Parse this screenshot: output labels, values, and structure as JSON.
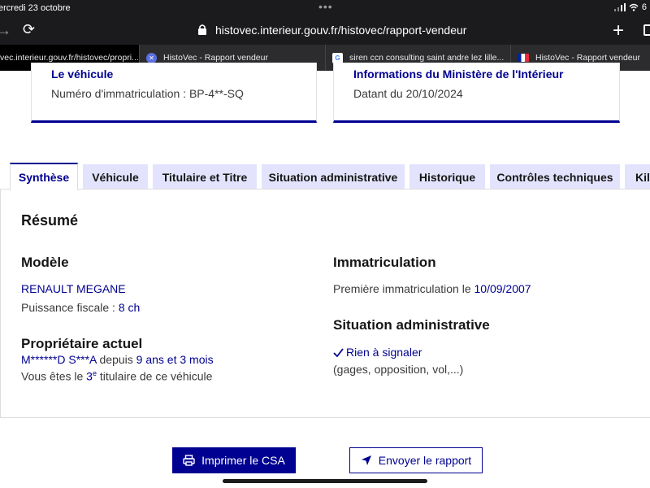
{
  "status_bar": {
    "date": "ercredi 23 octobre",
    "battery": "6"
  },
  "address_bar": {
    "url": "histovec.interieur.gouv.fr/histovec/rapport-vendeur"
  },
  "browser_tabs": [
    {
      "label": "vec.interieur.gouv.fr/histovec/propri...",
      "favicon": "none"
    },
    {
      "label": "HistoVec - Rapport vendeur",
      "favicon": "histovec-icon"
    },
    {
      "label": "siren ccn consulting saint andre lez lille...",
      "favicon": "google-icon"
    },
    {
      "label": "HistoVec - Rapport vendeur",
      "favicon": "french-flag-icon"
    }
  ],
  "cards": {
    "left": {
      "title": "Le véhicule",
      "text": "Numéro d'immatriculation : BP-4**-SQ"
    },
    "right": {
      "title": "Informations du Ministère de l'Intérieur",
      "text": "Datant du 20/10/2024"
    }
  },
  "tabs": [
    "Synthèse",
    "Véhicule",
    "Titulaire et Titre",
    "Situation administrative",
    "Historique",
    "Contrôles techniques",
    "Kilo"
  ],
  "summary": {
    "heading": "Résumé",
    "modele": {
      "heading": "Modèle",
      "name": "RENAULT MEGANE",
      "power_label": "Puissance fiscale : ",
      "power_value": "8 ch"
    },
    "immatriculation": {
      "heading": "Immatriculation",
      "first_label": "Première immatriculation le ",
      "first_date": "10/09/2007"
    },
    "proprietaire": {
      "heading": "Propriétaire actuel",
      "owner": "M******D S***A",
      "since_label": " depuis ",
      "duration": "9 ans et 3 mois",
      "rank_prefix": "Vous êtes le ",
      "rank_num": "3",
      "rank_sup": "e",
      "rank_suffix": " titulaire de ce véhicule"
    },
    "situation": {
      "heading": "Situation administrative",
      "status": "Rien à signaler",
      "details": "(gages, opposition, vol,...)"
    }
  },
  "actions": {
    "print": "Imprimer le CSA",
    "send": "Envoyer le rapport"
  }
}
